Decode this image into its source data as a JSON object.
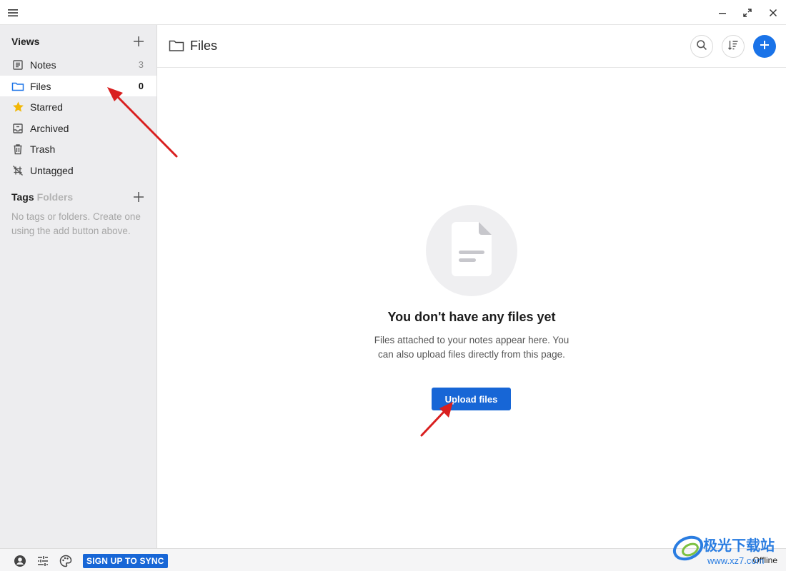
{
  "colors": {
    "accent": "#1a73e8",
    "button": "#1766d6",
    "star": "#f2b705",
    "sidebar_bg": "#ededef",
    "annotation_arrow": "#d91f1f"
  },
  "titlebar": {
    "menu_icon": "hamburger-icon",
    "minimize_icon": "minimize-icon",
    "maximize_icon": "maximize-icon",
    "close_icon": "close-icon"
  },
  "sidebar": {
    "views_title": "Views",
    "items": [
      {
        "label": "Notes",
        "count": "3",
        "icon": "note-icon"
      },
      {
        "label": "Files",
        "count": "0",
        "icon": "folder-icon",
        "active": true
      },
      {
        "label": "Starred",
        "count": "",
        "icon": "star-icon"
      },
      {
        "label": "Archived",
        "count": "",
        "icon": "archive-icon"
      },
      {
        "label": "Trash",
        "count": "",
        "icon": "trash-icon"
      },
      {
        "label": "Untagged",
        "count": "",
        "icon": "untagged-icon"
      }
    ],
    "tags_title": "Tags",
    "folders_label": "Folders",
    "empty_text": "No tags or folders. Create one using the add button above."
  },
  "header": {
    "title": "Files",
    "icons": [
      "search-icon",
      "sort-icon",
      "plus-icon"
    ]
  },
  "empty_state": {
    "title": "You don't have any files yet",
    "description": "Files attached to your notes appear here. You can also upload files directly from this page.",
    "upload_label": "Upload files"
  },
  "footer": {
    "sync_label": "SIGN UP TO SYNC",
    "status": "Offline"
  },
  "watermark": {
    "text": "极光下载站",
    "url": "www.xz7.com"
  }
}
